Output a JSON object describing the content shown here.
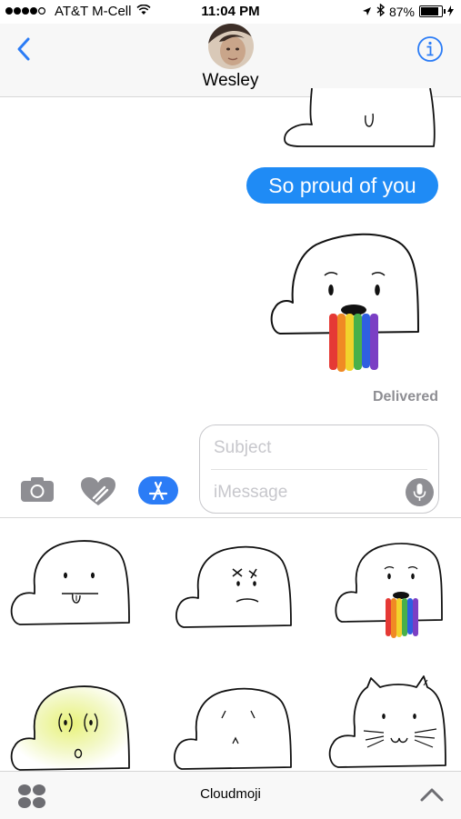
{
  "status_bar": {
    "carrier": "AT&T M-Cell",
    "time": "11:04 PM",
    "battery": "87%"
  },
  "header": {
    "contact_name": "Wesley"
  },
  "thread": {
    "message": "So proud of you",
    "delivery_status": "Delivered"
  },
  "compose": {
    "subject_placeholder": "Subject",
    "message_placeholder": "iMessage"
  },
  "drawer": {
    "app_name": "Cloudmoji"
  },
  "colors": {
    "bubble_blue": "#1f8bf5",
    "accent_blue": "#2b7cf6"
  }
}
